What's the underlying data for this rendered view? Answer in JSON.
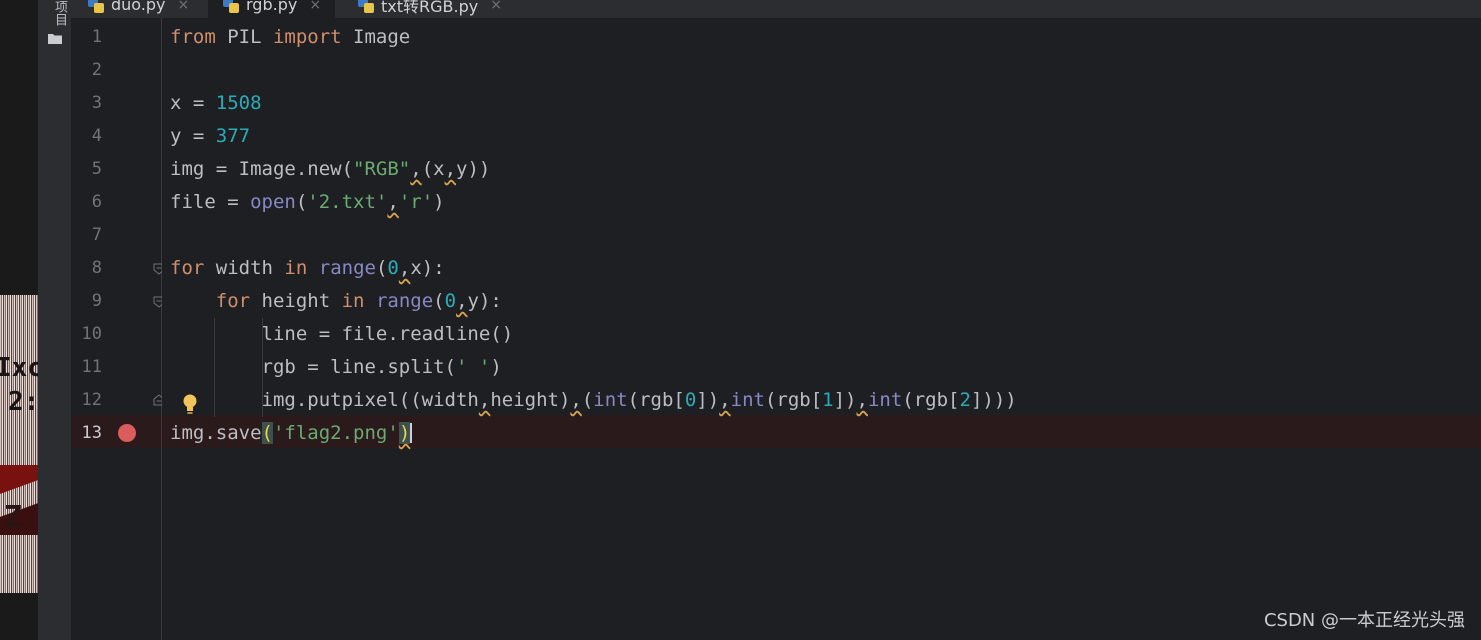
{
  "side_panel": {
    "label": "项目"
  },
  "tabs": [
    {
      "name": "duo.py",
      "close": "×",
      "active": false
    },
    {
      "name": "rgb.py",
      "close": "×",
      "active": true
    },
    {
      "name": "txt转RGB.py",
      "close": "×",
      "active": false
    }
  ],
  "line_numbers": [
    "1",
    "2",
    "3",
    "4",
    "5",
    "6",
    "7",
    "8",
    "9",
    "10",
    "11",
    "12",
    "13"
  ],
  "code": {
    "l1": {
      "kw1": "from",
      "mod": " PIL ",
      "kw2": "import",
      "name": " Image"
    },
    "l3": {
      "lhs": "x = ",
      "val": "1508"
    },
    "l4": {
      "lhs": "y = ",
      "val": "377"
    },
    "l5": {
      "lhs": "img = Image.new(",
      "s": "\"RGB\"",
      "c1": ",",
      "p1": "(x",
      "c2": ",",
      "p2": "y))"
    },
    "l6": {
      "lhs": "file = ",
      "fn": "open",
      "p1": "(",
      "s1": "'2.txt'",
      "c1": ",",
      "s2": "'r'",
      "p2": ")"
    },
    "l8": {
      "kw": "for",
      "a": " width ",
      "in": "in",
      "sp": " ",
      "fn": "range",
      "p1": "(",
      "n": "0",
      "c": ",",
      "p2": "x):"
    },
    "l9": {
      "ind": "    ",
      "kw": "for",
      "a": " height ",
      "in": "in",
      "sp": " ",
      "fn": "range",
      "p1": "(",
      "n": "0",
      "c": ",",
      "p2": "y):"
    },
    "l10": {
      "text": "        line = file.readline()"
    },
    "l11": {
      "a": "        rgb = line.split(",
      "s": "' '",
      "b": ")"
    },
    "l12": {
      "a": "        img.putpixel((width",
      "c1": ",",
      "b": "height)",
      "c2": ",",
      "p": "(",
      "f1": "int",
      "r1": "(rgb[",
      "n1": "0",
      "e1": "])",
      "c3": ",",
      "f2": "int",
      "r2": "(rgb[",
      "n2": "1",
      "e2": "])",
      "c4": ",",
      "f3": "int",
      "r3": "(rgb[",
      "n3": "2",
      "e3": "])))"
    },
    "l13": {
      "a": "img.save",
      "o": "(",
      "s": "'flag2.png'",
      "cl": ")"
    }
  },
  "watermark": "CSDN @一本正经光头强",
  "colors": {
    "keyword": "#cf8e6d",
    "number": "#2aacb8",
    "string": "#6aab73",
    "builtin": "#8888c6",
    "breakpoint": "#db5c5c"
  }
}
